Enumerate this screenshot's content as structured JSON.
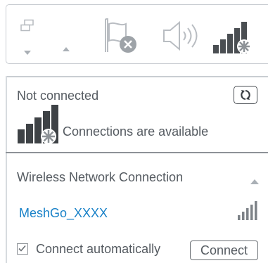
{
  "tray": {
    "icons": [
      "network-window-icon",
      "chevron-down-icon",
      "chevron-up-icon",
      "flag-error-icon",
      "speaker-icon",
      "wifi-signal-icon"
    ]
  },
  "status": {
    "title": "Not connected",
    "available": "Connections are available"
  },
  "section": {
    "title": "Wireless Network Connection"
  },
  "network": {
    "ssid": "MeshGo_XXXX",
    "signal_bars": 5
  },
  "connect": {
    "auto_label": "Connect automatically",
    "auto_checked": true,
    "button_label": "Connect"
  },
  "colors": {
    "link": "#1a82c8",
    "text": "#555b61",
    "icon": "#4a4e52"
  }
}
